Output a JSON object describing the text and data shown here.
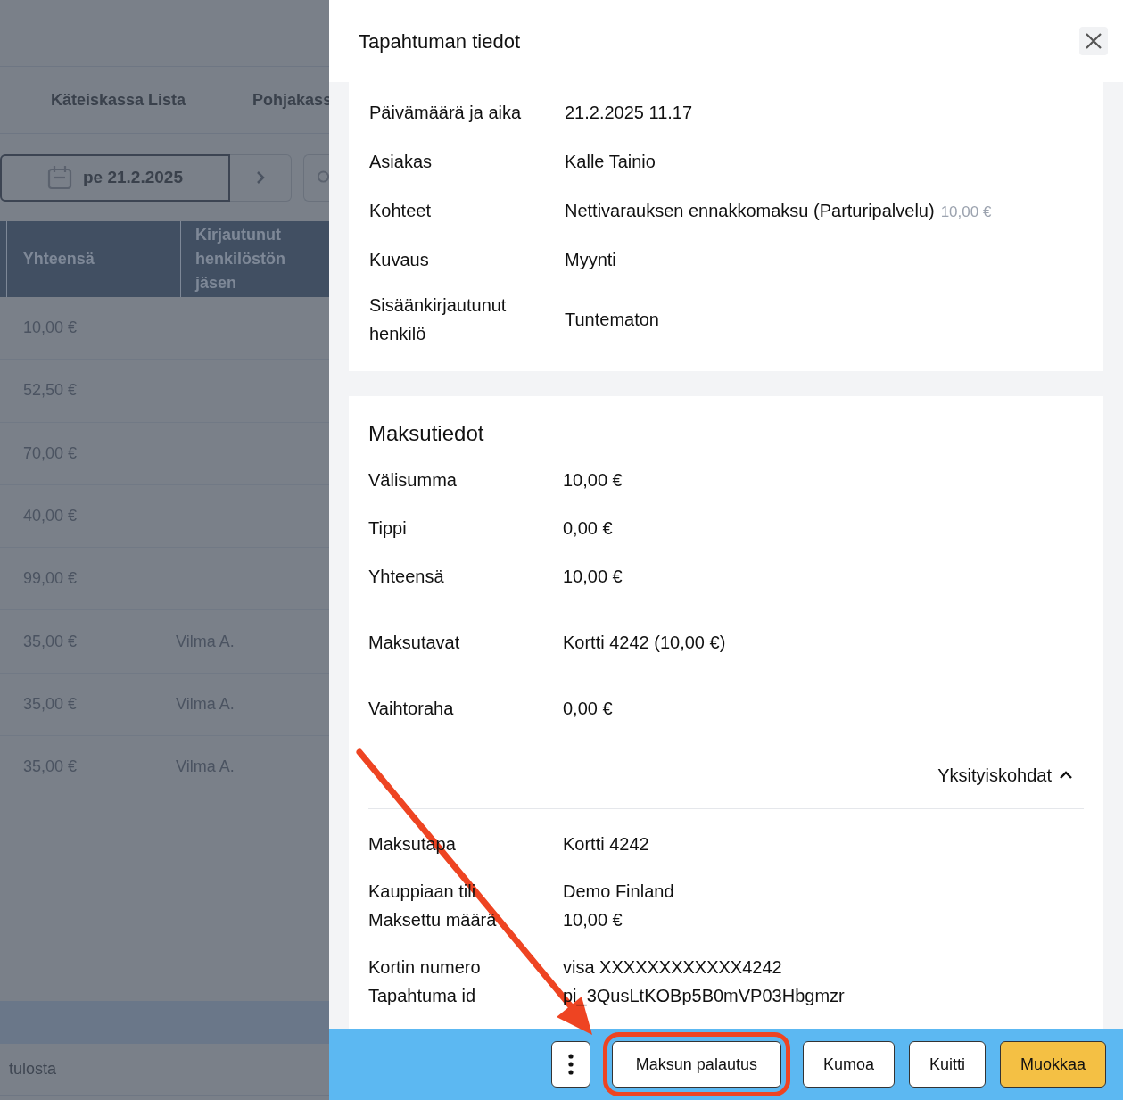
{
  "background_page": {
    "tabs": [
      "Käteiskassa Lista",
      "Pohjakass"
    ],
    "date_picker": {
      "value": "pe 21.2.2025"
    },
    "table": {
      "columns": [
        "Yhteensä",
        "Kirjautunut henkilöstön jäsen"
      ],
      "rows": [
        {
          "total": "10,00 €"
        },
        {
          "total": "52,50 €"
        },
        {
          "total": "70,00 €"
        },
        {
          "total": "40,00 €"
        },
        {
          "total": "99,00 €"
        },
        {
          "total": "35,00 €",
          "staff": "Vilma A."
        },
        {
          "total": "35,00 €",
          "staff": "Vilma A."
        },
        {
          "total": "35,00 €",
          "staff": "Vilma A."
        }
      ]
    },
    "results": "tulosta"
  },
  "panel": {
    "title": "Tapahtuman tiedot",
    "details": [
      {
        "label": "Päivämäärä ja aika",
        "value": "21.2.2025 11.17"
      },
      {
        "label": "Asiakas",
        "value": "Kalle Tainio"
      },
      {
        "label": "Kohteet",
        "value": "Nettivarauksen ennakkomaksu (Parturipalvelu)",
        "price": "10,00 €"
      },
      {
        "label": "Kuvaus",
        "value": "Myynti"
      },
      {
        "label": "Sisäänkirjautunut henkilö",
        "value": "Tuntematon"
      }
    ],
    "payment": {
      "title": "Maksutiedot",
      "groups": [
        [
          {
            "label": "Välisumma",
            "value": "10,00 €"
          },
          {
            "label": "Tippi",
            "value": "0,00 €"
          },
          {
            "label": "Yhteensä",
            "value": "10,00 €"
          }
        ],
        [
          {
            "label": "Maksutavat",
            "value": "Kortti 4242 (10,00 €)"
          }
        ],
        [
          {
            "label": "Vaihtoraha",
            "value": "0,00 €"
          }
        ]
      ],
      "toggle": {
        "label": "Yksityiskohdat",
        "expanded": true
      },
      "detail_groups": [
        [
          {
            "label": "Maksutapa",
            "value": "Kortti 4242"
          }
        ],
        [
          {
            "label": "Kauppiaan tili",
            "value": "Demo Finland"
          },
          {
            "label": "Maksettu määrä",
            "value": "10,00 €"
          }
        ],
        [
          {
            "label": "Kortin numero",
            "value": "visa XXXXXXXXXXXX4242"
          },
          {
            "label": "Tapahtuma id",
            "value": "pi_3QusLtKOBp5B0mVP03Hbgmzr"
          }
        ]
      ]
    }
  },
  "buttons": [
    {
      "kind": "more",
      "highlighted": false,
      "primary": false
    },
    {
      "kind": "text",
      "label": "Maksun palautus",
      "highlighted": true,
      "primary": false
    },
    {
      "kind": "text",
      "label": "Kumoa",
      "highlighted": false,
      "primary": false
    },
    {
      "kind": "text",
      "label": "Kuitti",
      "highlighted": false,
      "primary": false
    },
    {
      "kind": "text",
      "label": "Muokkaa",
      "highlighted": false,
      "primary": true
    }
  ],
  "annotation": {
    "arrow": true
  }
}
